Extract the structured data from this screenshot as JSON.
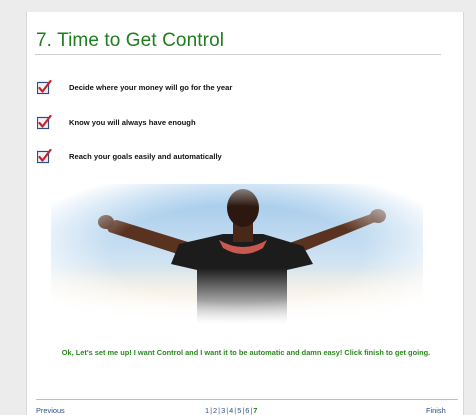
{
  "page": {
    "title": "7. Time to Get Control"
  },
  "checklist": [
    {
      "label": "Decide where your money will go for the year"
    },
    {
      "label": "Know you will always have enough"
    },
    {
      "label": "Reach your goals easily and automatically"
    }
  ],
  "icons": {
    "checklist_item": "checkbox-checked-icon"
  },
  "cta": {
    "text": "Ok, Let's set me up! I want Control and I want it to be automatic and damn easy! Click finish to get going."
  },
  "footer": {
    "previous_label": "Previous",
    "finish_label": "Finish",
    "pages": [
      "1",
      "2",
      "3",
      "4",
      "5",
      "6",
      "7"
    ],
    "separator": "|",
    "current_page": "7"
  },
  "colors": {
    "title": "#1f7d1f",
    "cta": "#2a8a1e",
    "link": "#2a4f8a",
    "check_red": "#c8232a"
  }
}
